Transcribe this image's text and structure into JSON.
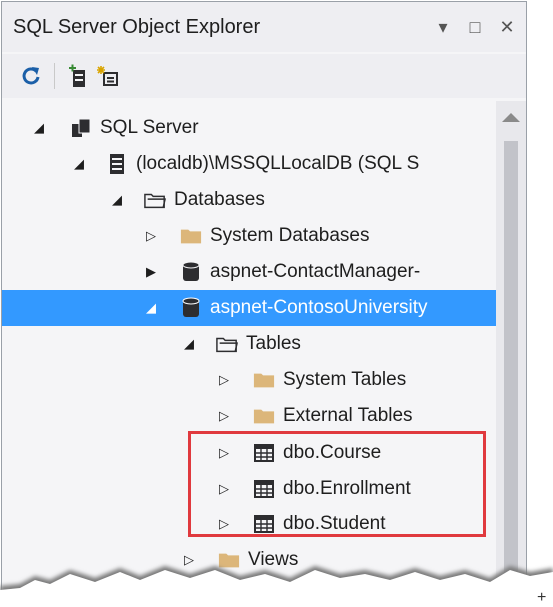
{
  "panel": {
    "title": "SQL Server Object Explorer",
    "controls": {
      "dropdown": "▾",
      "maximize": "□",
      "close": "✕"
    }
  },
  "toolbar": {
    "buttons": [
      {
        "name": "refresh-icon"
      },
      {
        "name": "add-sql-server-icon"
      },
      {
        "name": "new-query-icon"
      }
    ]
  },
  "tree": {
    "items": [
      {
        "label": "SQL Server",
        "expanded": true,
        "icon": "server-group-icon"
      },
      {
        "label": "(localdb)\\MSSQLLocalDB (SQL S",
        "expanded": true,
        "icon": "server-icon"
      },
      {
        "label": "Databases",
        "expanded": true,
        "icon": "folder-open-icon"
      },
      {
        "label": "System Databases",
        "expanded": false,
        "icon": "folder-icon"
      },
      {
        "label": "aspnet-ContactManager-",
        "expanded": false,
        "icon": "database-icon"
      },
      {
        "label": "aspnet-ContosoUniversity",
        "expanded": true,
        "icon": "database-icon",
        "selected": true
      },
      {
        "label": "Tables",
        "expanded": true,
        "icon": "folder-open-icon"
      },
      {
        "label": "System Tables",
        "expanded": false,
        "icon": "folder-icon"
      },
      {
        "label": "External Tables",
        "expanded": false,
        "icon": "folder-icon"
      },
      {
        "label": "dbo.Course",
        "expanded": false,
        "icon": "table-icon"
      },
      {
        "label": "dbo.Enrollment",
        "expanded": false,
        "icon": "table-icon"
      },
      {
        "label": "dbo.Student",
        "expanded": false,
        "icon": "table-icon"
      },
      {
        "label": "Views",
        "expanded": false,
        "icon": "folder-icon"
      }
    ]
  },
  "colors": {
    "selection": "#3399ff",
    "highlight_border": "#e0393e",
    "folder": "#dcb67a"
  },
  "corner_mark": "+"
}
